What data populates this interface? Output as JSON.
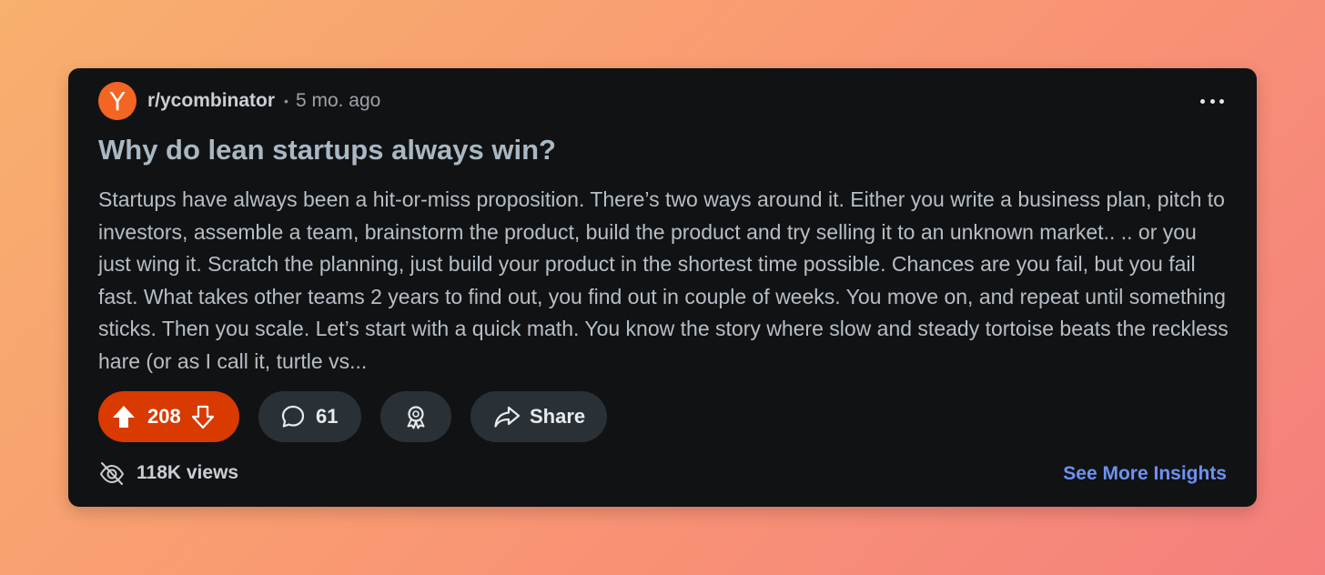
{
  "post": {
    "avatar_letter": "Y",
    "subreddit": "r/ycombinator",
    "separator": "•",
    "age": "5 mo. ago",
    "title": "Why do lean startups always win?",
    "body": "Startups have always been a hit-or-miss proposition. There’s two ways around it. Either you write a business plan, pitch to investors, assemble a team, brainstorm the product, build the product and try selling it to an unknown market.. .. or you just wing it. Scratch the planning, just build your product in the shortest time possible. Chances are you fail, but you fail fast. What takes other teams 2 years to find out, you find out in couple of weeks. You move on, and repeat until something sticks. Then you scale. Let’s start with a quick math. You know the story where slow and steady tortoise beats the reckless hare (or as I call it, turtle vs..."
  },
  "actions": {
    "votes": "208",
    "comments": "61",
    "share_label": "Share"
  },
  "footer": {
    "views": "118K views",
    "insights_label": "See More Insights"
  },
  "colors": {
    "accent_vote": "#d93a00",
    "avatar": "#f26522",
    "link": "#6e92f2",
    "card_bg": "#111214"
  },
  "icons": {
    "more": "more-horizontal-icon",
    "upvote": "upvote-arrow-icon",
    "downvote": "downvote-arrow-icon",
    "comment": "comment-bubble-icon",
    "award": "award-icon",
    "share": "share-arrow-icon",
    "views": "views-eye-icon"
  }
}
